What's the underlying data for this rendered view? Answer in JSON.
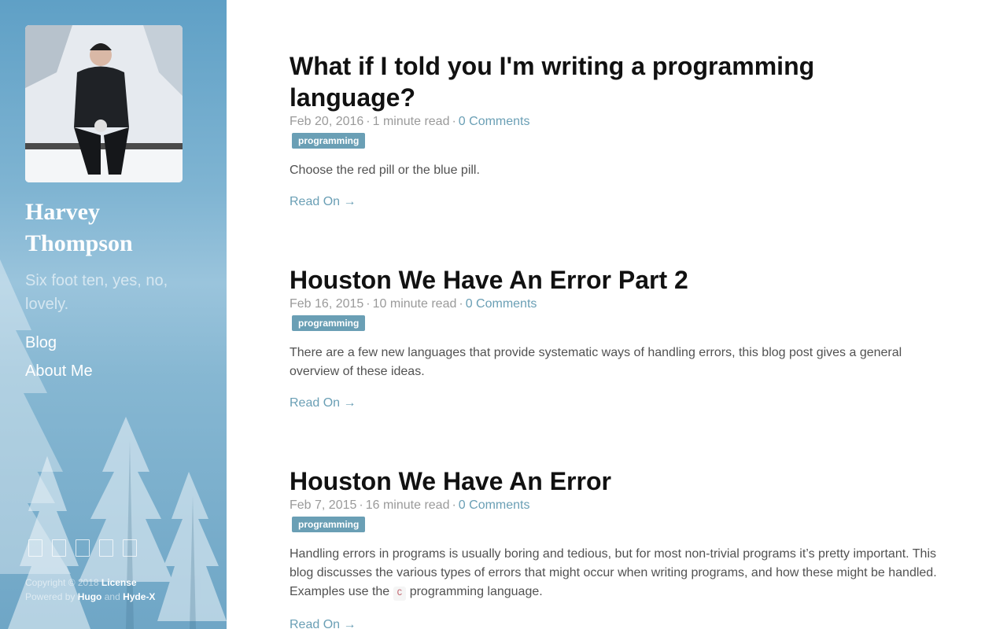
{
  "sidebar": {
    "site_name": "Harvey Thompson",
    "tagline": "Six foot ten, yes, no, lovely.",
    "nav": [
      {
        "label": "Blog"
      },
      {
        "label": "About Me"
      }
    ],
    "social_icons": [
      "github-icon",
      "twitter-icon",
      "linkedin-icon",
      "stackoverflow-icon",
      "rss-icon"
    ],
    "footer": {
      "copyright": "Copyright © 2018",
      "license": "License",
      "powered_by": "Powered by",
      "hugo": "Hugo",
      "and": "and",
      "hyde": "Hyde-X"
    }
  },
  "posts": [
    {
      "title": "What if I told you I'm writing a programming language?",
      "date": "Feb 20, 2016",
      "read_time": "1 minute read",
      "comments": "0 Comments",
      "tag": "programming",
      "summary": "Choose the red pill or the blue pill.",
      "read_on": "Read On →"
    },
    {
      "title": "Houston We Have An Error Part 2",
      "date": "Feb 16, 2015",
      "read_time": "10 minute read",
      "comments": "0 Comments",
      "tag": "programming",
      "summary": "There are a few new languages that provide systematic ways of handling errors, this blog post gives a general overview of these ideas.",
      "read_on": "Read On →"
    },
    {
      "title": "Houston We Have An Error",
      "date": "Feb 7, 2015",
      "read_time": "16 minute read",
      "comments": "0 Comments",
      "tag": "programming",
      "summary_before": "Handling errors in programs is usually boring and tedious, but for most non-trivial programs it’s pretty important. This blog discusses the various types of errors that might occur when writing programs, and how these might be handled. Examples use the",
      "summary_code": "C",
      "summary_after": "programming language.",
      "read_on": "Read On →"
    }
  ],
  "colors": {
    "accent": "#6a9fb5",
    "sidebar": "#6fa6c6",
    "title": "#111111",
    "body_text": "#515151"
  }
}
